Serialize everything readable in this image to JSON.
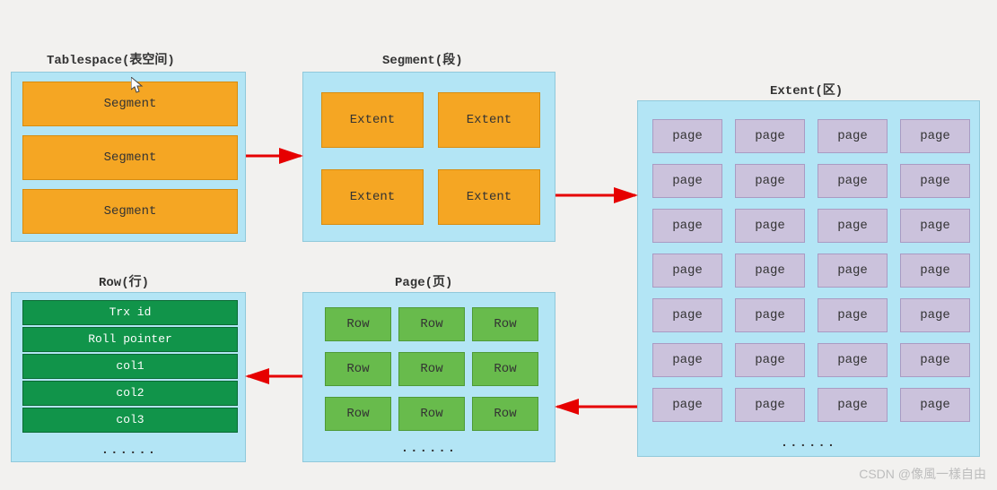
{
  "titles": {
    "tablespace": "Tablespace(表空间)",
    "segment": "Segment(段)",
    "extent": "Extent(区)",
    "page": "Page(页)",
    "row": "Row(行)"
  },
  "tablespace": {
    "items": [
      "Segment",
      "Segment",
      "Segment"
    ]
  },
  "segment": {
    "items": [
      "Extent",
      "Extent",
      "Extent",
      "Extent"
    ]
  },
  "extent": {
    "page_label": "page",
    "ellipsis": "......"
  },
  "page": {
    "row_label": "Row",
    "ellipsis": "......"
  },
  "row": {
    "items": [
      "Trx id",
      "Roll pointer",
      "col1",
      "col2",
      "col3"
    ],
    "ellipsis": "......"
  },
  "watermark": "CSDN @像風一樣自由",
  "chart_data": {
    "type": "diagram",
    "title": "InnoDB Logical Storage Structure",
    "hierarchy": [
      "Tablespace",
      "Segment",
      "Extent",
      "Page",
      "Row"
    ],
    "edges": [
      [
        "Tablespace",
        "Segment"
      ],
      [
        "Segment",
        "Extent"
      ],
      [
        "Extent",
        "Page"
      ],
      [
        "Page",
        "Row"
      ]
    ],
    "tablespace_segments_shown": 3,
    "segment_extents_shown": 4,
    "extent_pages_shown": 28,
    "page_rows_shown": 9,
    "row_fields_shown": [
      "Trx id",
      "Roll pointer",
      "col1",
      "col2",
      "col3",
      "..."
    ]
  }
}
